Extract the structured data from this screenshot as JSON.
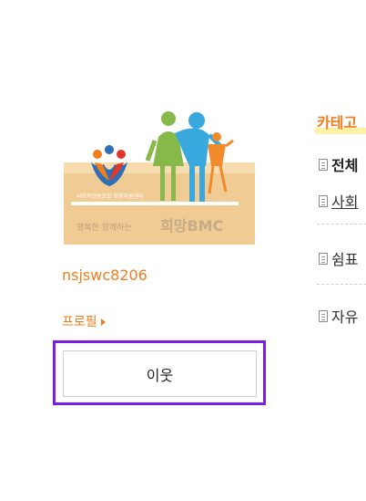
{
  "profile": {
    "logo_org_text": "사회적협동조합 희망지원센터",
    "logo_main_text": "희망BMC",
    "logo_sub_text": "행복한 함께하는",
    "blog_id": "nsjswc8206",
    "profile_link": "프로필",
    "neighbor_button": "이웃"
  },
  "category": {
    "title": "카테고",
    "items": [
      {
        "label": "전체"
      },
      {
        "label": "사회"
      },
      {
        "label": "쉼표"
      },
      {
        "label": "자유"
      }
    ]
  },
  "colors": {
    "accent": "#f07d1e",
    "focus": "#7a1fe3",
    "highlight": "#fff2a8"
  }
}
